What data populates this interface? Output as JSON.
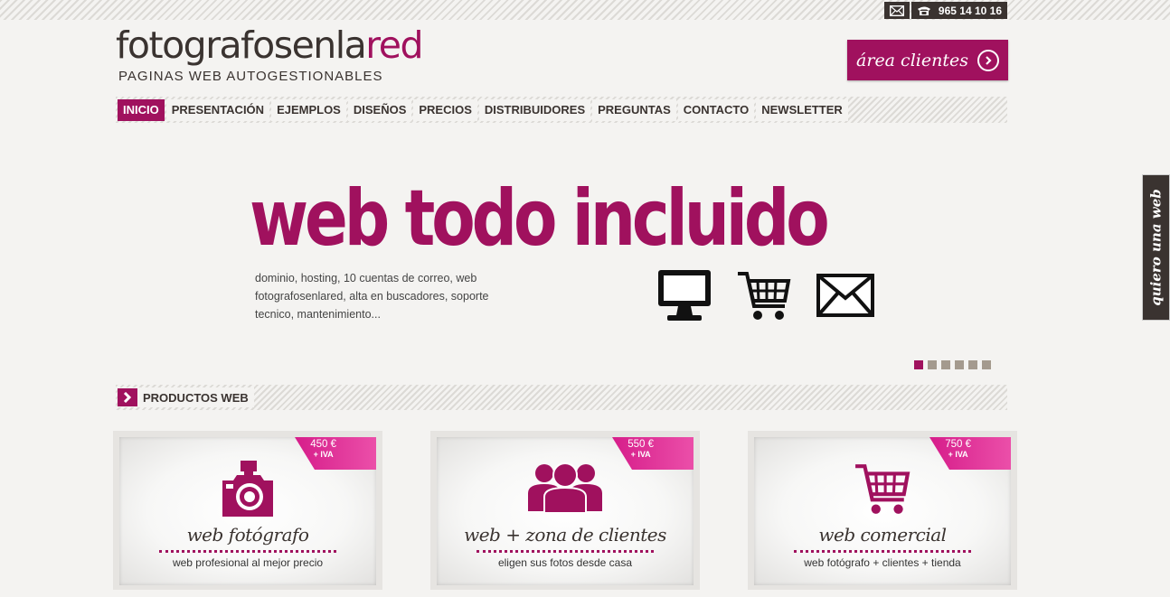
{
  "topbar": {
    "mail_icon": "envelope-icon",
    "phone_icon": "phone-icon",
    "phone": "965 14 10 16"
  },
  "logo": {
    "brand_part1": "fotografosenla",
    "brand_part2": "red",
    "tagline": "PAGINAS WEB AUTOGESTIONABLES"
  },
  "area_button": {
    "label": "área clientes",
    "icon": "chevron-right-circle-icon"
  },
  "nav": {
    "items": [
      {
        "label": "INICIO",
        "active": true
      },
      {
        "label": "PRESENTACIÓN"
      },
      {
        "label": "EJEMPLOS"
      },
      {
        "label": "DISEÑOS"
      },
      {
        "label": "PRECIOS"
      },
      {
        "label": "DISTRIBUIDORES"
      },
      {
        "label": "PREGUNTAS"
      },
      {
        "label": "CONTACTO"
      },
      {
        "label": "NEWSLETTER"
      }
    ]
  },
  "hero": {
    "title": "web todo incluido",
    "text": "dominio, hosting, 10 cuentas de correo, web fotografosenlared, alta en buscadores, soporte tecnico, mantenimiento...",
    "icons": [
      "monitor-icon",
      "cart-icon",
      "mail-icon"
    ]
  },
  "slider": {
    "count": 6,
    "active_index": 0
  },
  "section": {
    "title": "PRODUCTOS WEB",
    "icon": "chevron-right-icon"
  },
  "products": [
    {
      "price": "450 €",
      "iva": "+ IVA",
      "name": "web fotógrafo",
      "desc": "web profesional al mejor precio",
      "icon": "camera-icon"
    },
    {
      "price": "550 €",
      "iva": "+ IVA",
      "name": "web + zona de clientes",
      "desc": "eligen sus fotos desde casa",
      "icon": "people-icon"
    },
    {
      "price": "750 €",
      "iva": "+ IVA",
      "name": "web comercial",
      "desc": "web fotógrafo + clientes + tienda",
      "icon": "cart-icon"
    }
  ],
  "side_tab": {
    "label": "quiero una web"
  },
  "colors": {
    "accent": "#a0115e",
    "dark": "#3a3330",
    "background": "#f4f3f1"
  }
}
